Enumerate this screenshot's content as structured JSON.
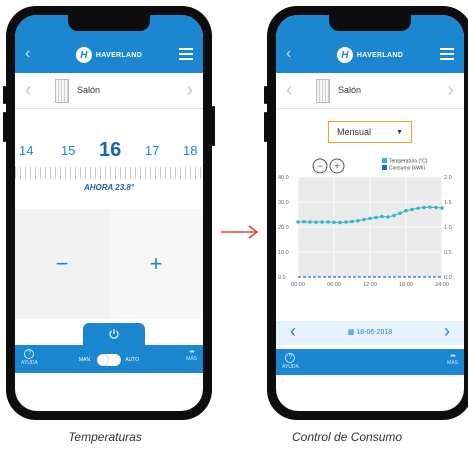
{
  "left_phone": {
    "brand": "HAVERLAND",
    "room": "Salón",
    "temps": [
      "14",
      "15",
      "16",
      "17",
      "18"
    ],
    "current": "AHORA 23.8°",
    "minus": "−",
    "plus": "+",
    "power_icon": "power-icon",
    "help": "AYUDA",
    "mode_man": "MAN.",
    "mode_auto": "AUTO",
    "more": "MÁS",
    "more_glyph": "•••",
    "help_glyph": "?"
  },
  "right_phone": {
    "brand": "HAVERLAND",
    "room": "Salón",
    "period": "Mensual",
    "zoom_out": "−",
    "zoom_in": "+",
    "date": "18-06-2018",
    "help": "AYUDA",
    "more": "MÁS",
    "more_glyph": "•••",
    "help_glyph": "?"
  },
  "captions": {
    "left": "Temperaturas",
    "right": "Control de Consumo"
  },
  "colors": {
    "primary": "#1a87d0",
    "accent": "#f0a030",
    "arrow": "#e0453a"
  },
  "chart_data": {
    "type": "line",
    "x": [
      "00:00",
      "06:00",
      "12:00",
      "18:00",
      "24:00"
    ],
    "ylim_left": [
      0,
      40
    ],
    "ylim_right": [
      0,
      2
    ],
    "left_ticks": [
      "0.0",
      "10.0",
      "20.0",
      "30.0",
      "40.0"
    ],
    "right_ticks": [
      "0.0",
      "0.5",
      "1.0",
      "1.5",
      "2.0"
    ],
    "series": [
      {
        "name": "Temperatura (°C)",
        "color": "#2fb6c8",
        "values": [
          22.0,
          22.1,
          22.0,
          21.9,
          22.0,
          22.0,
          21.9,
          21.8,
          22.0,
          22.2,
          22.5,
          23.0,
          23.4,
          23.8,
          24.2,
          24.0,
          24.6,
          25.5,
          26.5,
          27.0,
          27.5,
          27.8,
          27.9,
          27.8,
          27.6
        ]
      },
      {
        "name": "Consumo (kWh)",
        "color": "#1a6fb5",
        "values": [
          0.0,
          0.0,
          0.0,
          0.0,
          0.0,
          0.0,
          0.0,
          0.0,
          0.0,
          0.0,
          0.0,
          0.0,
          0.0,
          0.0,
          0.0,
          0.0,
          0.0,
          0.0,
          0.0,
          0.0,
          0.0,
          0.0,
          0.0,
          0.0,
          0.0
        ]
      }
    ]
  }
}
